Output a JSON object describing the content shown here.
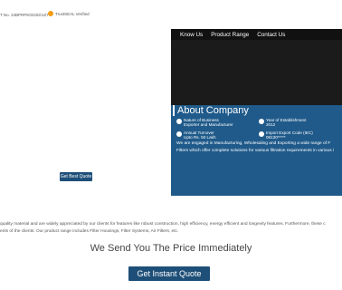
{
  "topbar": {
    "gst": "T No. 24BPRPK0225G1Z7",
    "trust_label": "TrustSEAL Verified"
  },
  "hero": {
    "small_quote_label": "Get Best Quote"
  },
  "nav": {
    "items": [
      "Know Us",
      "Product Range",
      "Contact Us"
    ]
  },
  "about": {
    "title": "About Company",
    "facts": [
      {
        "label": "Nature of Business",
        "value": "Exporter and Manufacturer"
      },
      {
        "label": "Year of Establishment",
        "value": "2012"
      },
      {
        "label": "Annual Turnover",
        "value": "Upto Rs. 50 Lakh"
      },
      {
        "label": "Import Export Code (IEC)",
        "value": "08130*****"
      }
    ],
    "desc_line1": "We are engaged in Manufacturing, Wholesaling and Exporting a wide range of F",
    "desc_line2": "Filters which offer complete solutions for various filtration requirements in various i"
  },
  "description": {
    "line1": "quality material and are widely appreciated by our clients for features like robust construction, high efficiency, energy efficient and longevity features. Furthermore, these c",
    "line2": "ents of the clients. Our product range includes Filter Housings, Filter Systems, Air Filters, etc."
  },
  "cta": {
    "heading": "We Send You The Price Immediately",
    "button": "Get Instant Quote"
  },
  "colors": {
    "brand_blue": "#1f5a8a",
    "button_blue": "#1e4f78",
    "nav_black": "#111111"
  }
}
